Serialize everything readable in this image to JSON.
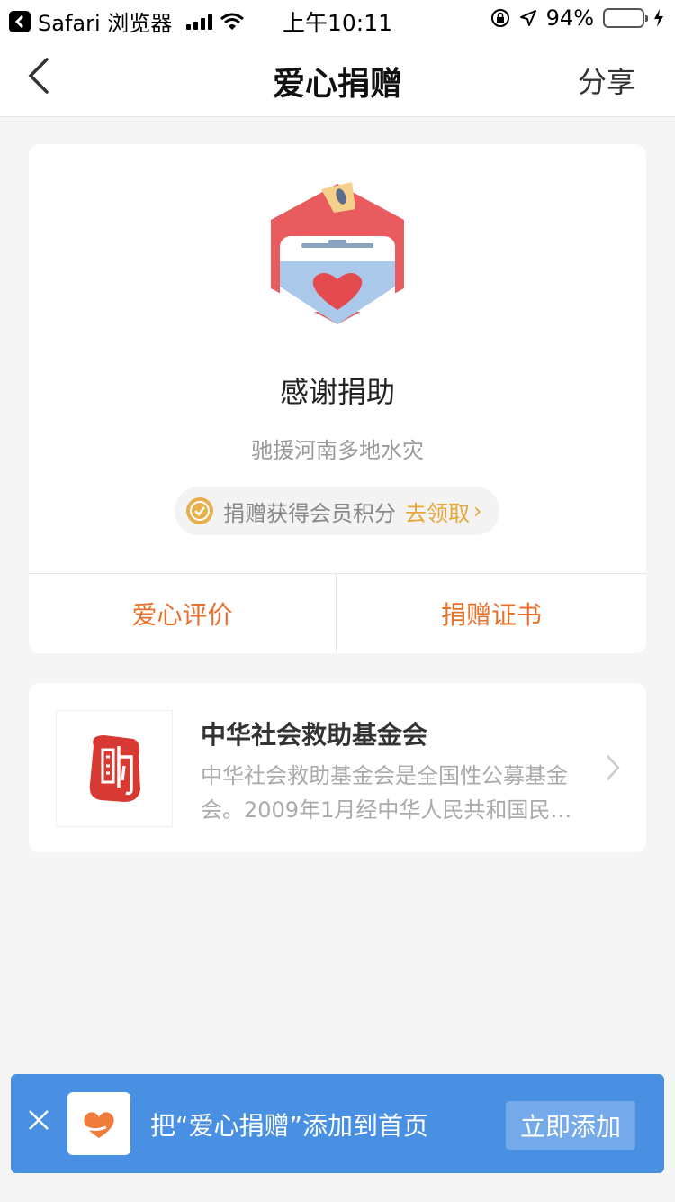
{
  "status_bar": {
    "back_app": "Safari 浏览器",
    "time": "上午10:11",
    "battery": "94%",
    "battery_level": 0.94
  },
  "nav": {
    "title": "爱心捐赠",
    "share": "分享"
  },
  "thanks": {
    "title": "感谢捐助",
    "project": "驰援河南多地水灾",
    "points_text": "捐赠获得会员积分",
    "points_action": "去领取",
    "chevron": "›"
  },
  "actions": {
    "evaluate": "爱心评价",
    "certificate": "捐赠证书"
  },
  "org": {
    "name": "中华社会救助基金会",
    "description": "中华社会救助基金会是全国性公募基金会。2009年1月经中华人民共和国民…"
  },
  "banner": {
    "text": "把“爱心捐赠”添加到首页",
    "button": "立即添加"
  },
  "colors": {
    "accent_orange": "#e8702a",
    "gold": "#e8a634",
    "banner_blue": "#4a90e2"
  }
}
